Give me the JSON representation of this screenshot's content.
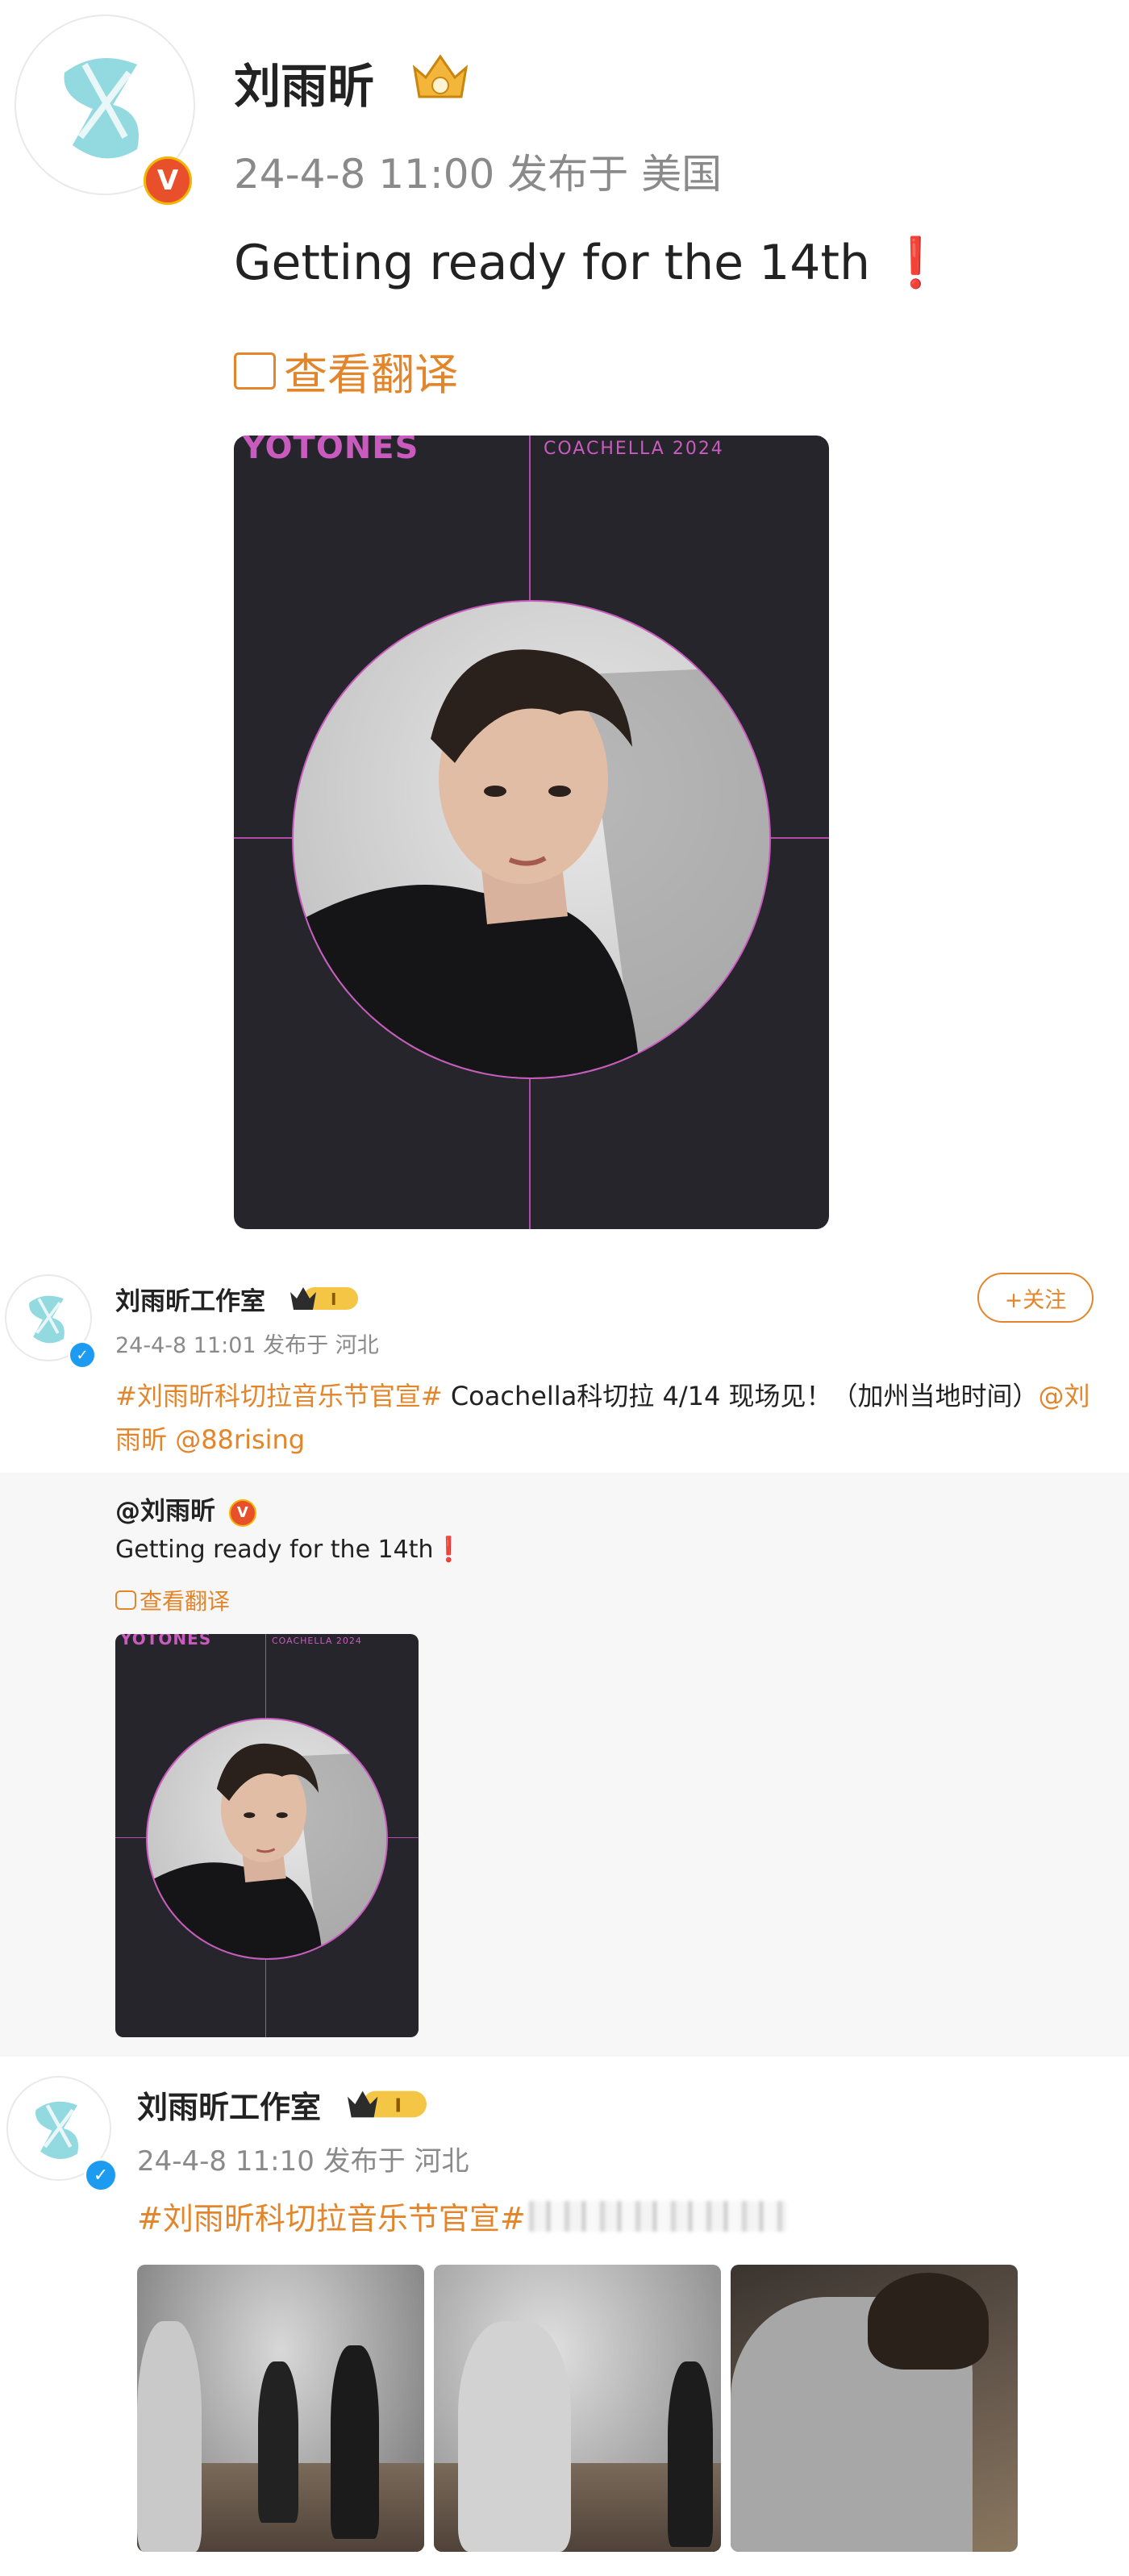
{
  "post1": {
    "author": "刘雨昕",
    "meta": "24-4-8 11:00  发布于 美国",
    "text": "Getting ready for the 14th ",
    "emoji": "❗",
    "translate": "查看翻译",
    "poster": {
      "brand": "YOTONES",
      "event": "COACHELLA 2024"
    }
  },
  "post2": {
    "author": "刘雨昕工作室",
    "meta": "24-4-8 11:01  发布于 河北",
    "follow": "+关注",
    "hashtag": "#刘雨昕科切拉音乐节官宣#",
    "text": " Coachella科切拉 4/14 现场见！（加州当地时间）",
    "mention1": "@刘雨昕",
    "mention2": "@88rising",
    "repost": {
      "author": "@刘雨昕",
      "text": "Getting ready for the 14th",
      "emoji": "❗",
      "translate": "查看翻译",
      "poster": {
        "brand": "YOTONES",
        "event": "COACHELLA 2024"
      }
    }
  },
  "post3": {
    "author": "刘雨昕工作室",
    "meta": "24-4-8 11:10  发布于 河北",
    "hashtag": "#刘雨昕科切拉音乐节官宣#"
  },
  "colors": {
    "accent": "#e3852b",
    "poster_bg": "#26252b",
    "poster_line": "#c95bbf",
    "verified_blue": "#1d9bf0",
    "verified_orange": "#e8502b"
  }
}
